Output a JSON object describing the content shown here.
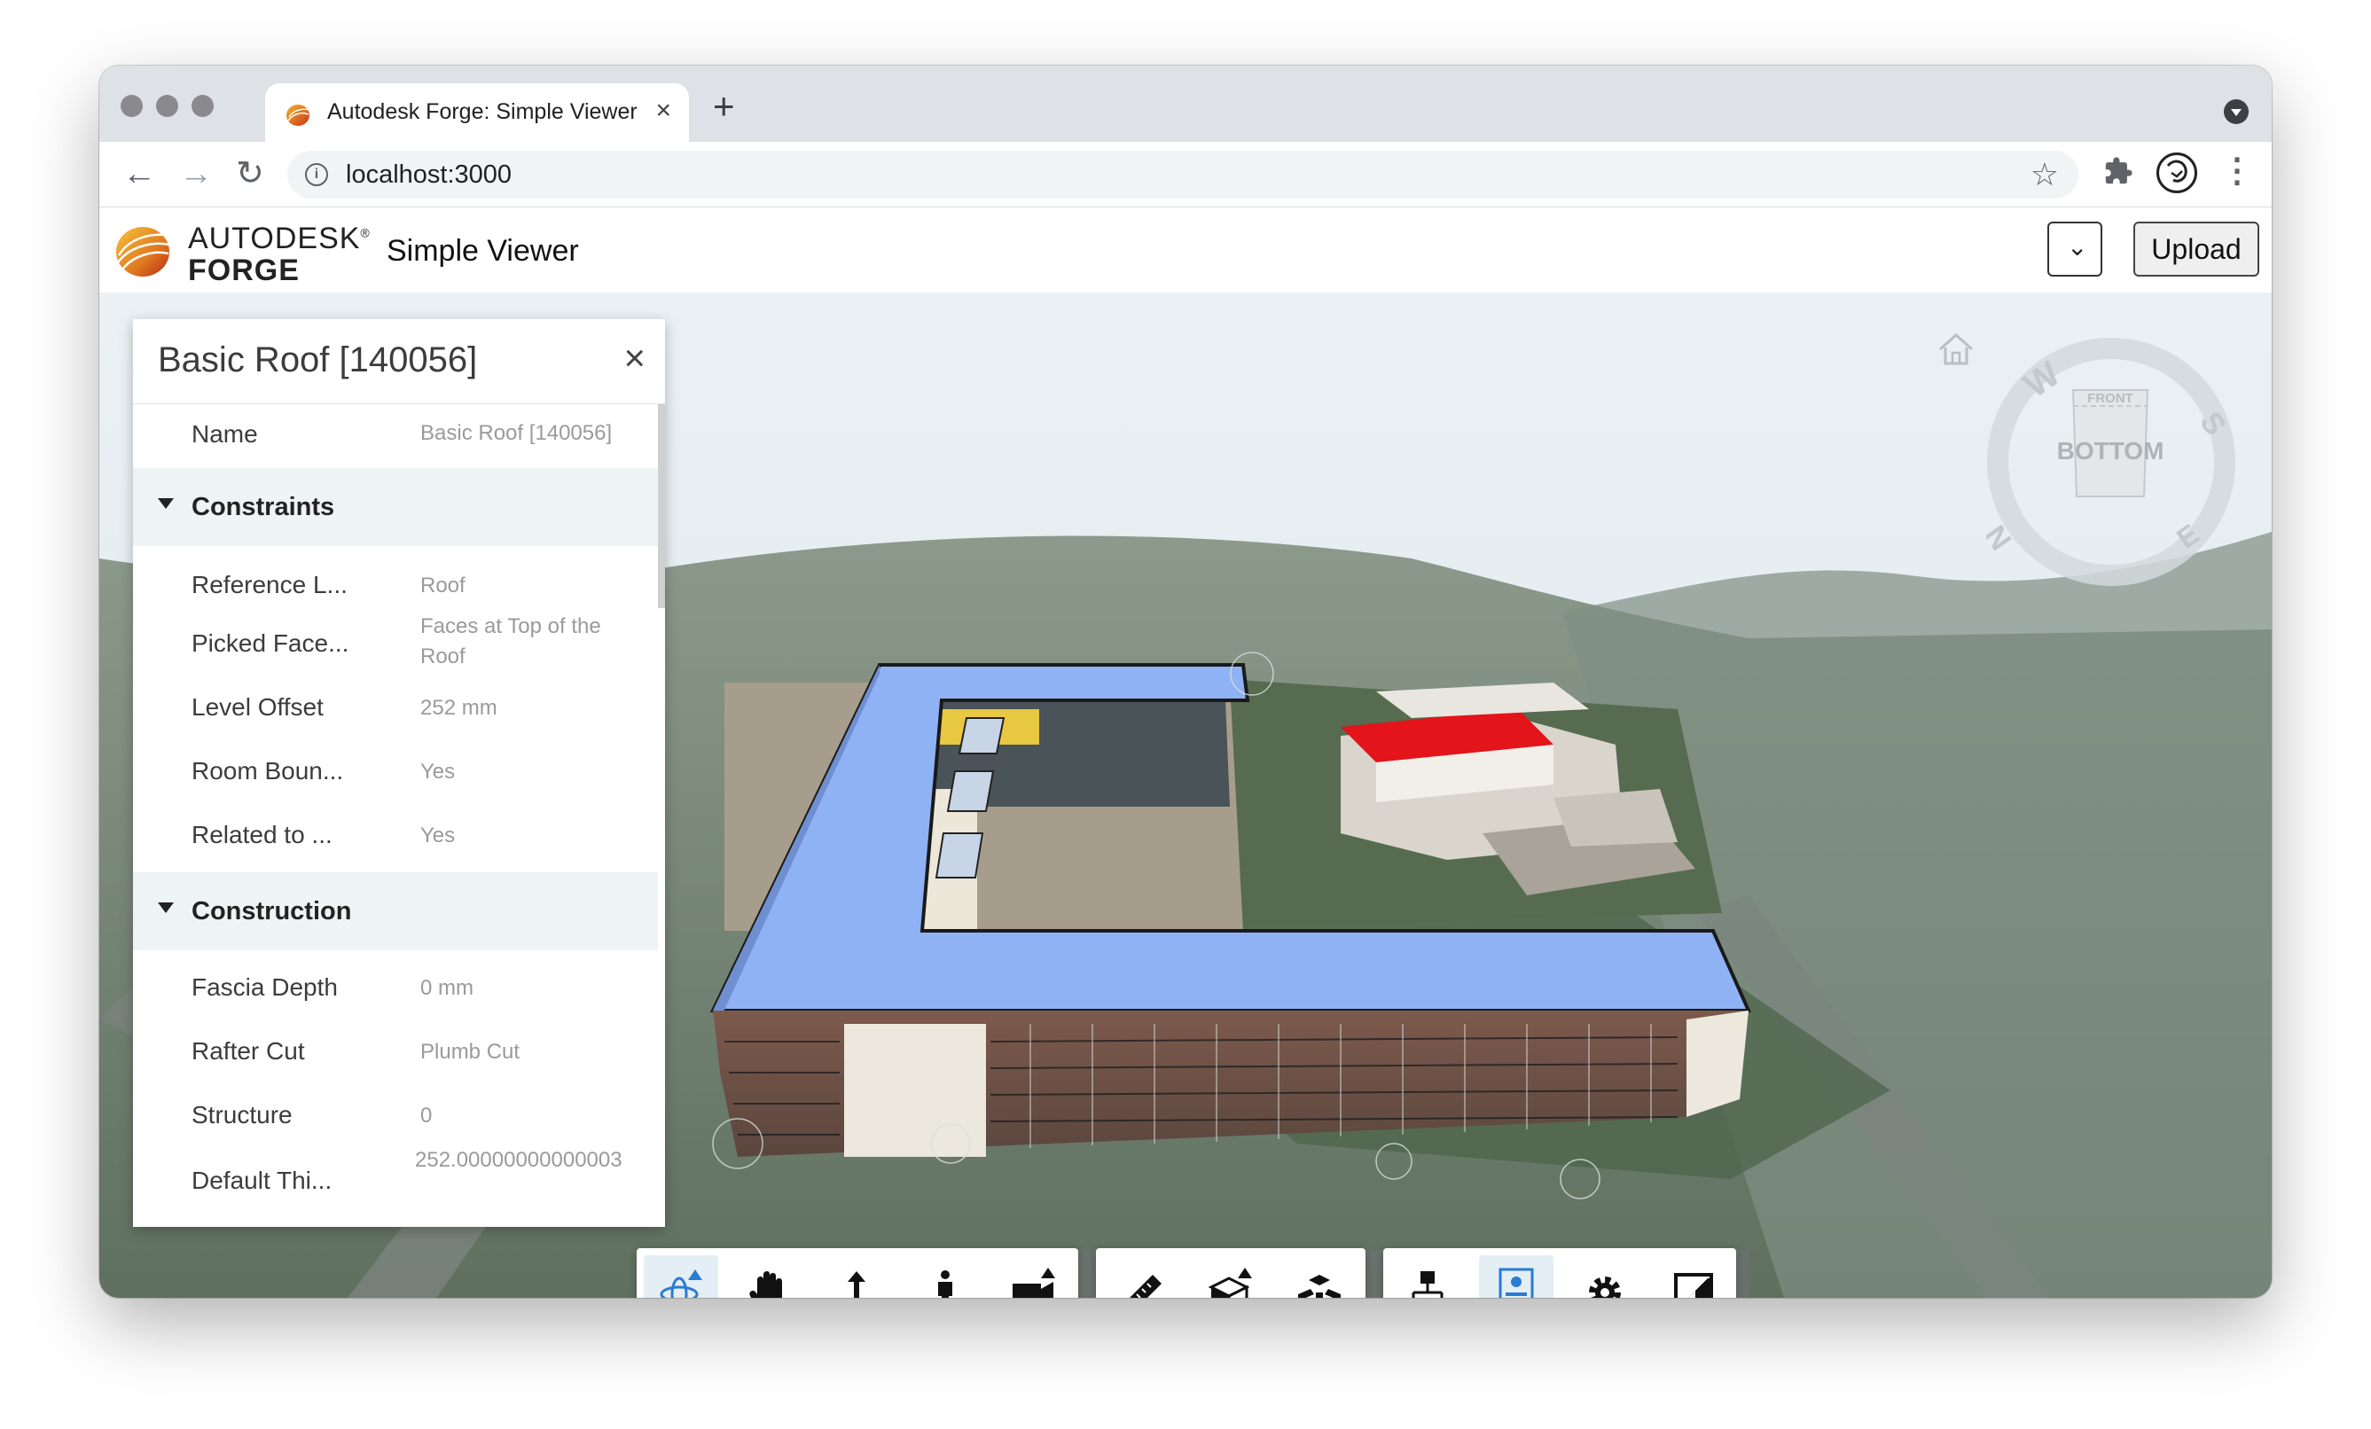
{
  "browser": {
    "tab_title": "Autodesk Forge: Simple Viewer",
    "url": "localhost:3000",
    "icons": [
      "back-icon",
      "forward-icon",
      "reload-icon",
      "info-icon",
      "star-icon",
      "extensions-icon",
      "profile-icon",
      "more-icon"
    ]
  },
  "app": {
    "brand_top": "AUTODESK",
    "brand_registered": "®",
    "brand_bottom": "FORGE",
    "title": "Simple Viewer",
    "upload_label": "Upload",
    "select_arrow": "⌄"
  },
  "properties": {
    "title": "Basic Roof [140056]",
    "rows": [
      {
        "name": "Name",
        "value": "Basic Roof [140056]"
      }
    ],
    "categories": [
      {
        "label": "Constraints",
        "rows": [
          {
            "name": "Reference L...",
            "value": "Roof"
          },
          {
            "name": "Picked Face...",
            "value": "Faces at Top of the Roof"
          },
          {
            "name": "Level Offset",
            "value": "252 mm"
          },
          {
            "name": "Room Boun...",
            "value": "Yes"
          },
          {
            "name": "Related to ...",
            "value": "Yes"
          }
        ]
      },
      {
        "label": "Construction",
        "rows": [
          {
            "name": "Fascia Depth",
            "value": "0 mm"
          },
          {
            "name": "Rafter Cut",
            "value": "Plumb Cut"
          },
          {
            "name": "Structure",
            "value": "0"
          },
          {
            "name": "Default Thi...",
            "value": "252.00000000000003"
          }
        ]
      }
    ]
  },
  "viewcube": {
    "face_top": "FRONT",
    "face_main": "BOTTOM",
    "compass": [
      "W",
      "S",
      "N",
      "E"
    ]
  },
  "toolbar": {
    "groups": [
      [
        "orbit-icon",
        "pan-icon",
        "dolly-icon",
        "first-person-icon",
        "camera-icon"
      ],
      [
        "measure-icon",
        "section-icon",
        "explode-icon"
      ],
      [
        "model-browser-icon",
        "properties-icon",
        "settings-icon",
        "fullscreen-icon"
      ]
    ],
    "active": [
      "orbit-icon",
      "properties-icon"
    ]
  },
  "colors": {
    "roof_blue": "#8fb2f5",
    "roof_red": "#e3141a",
    "ground_green": "#6e7f6e",
    "accent": "#2a7bd3"
  }
}
